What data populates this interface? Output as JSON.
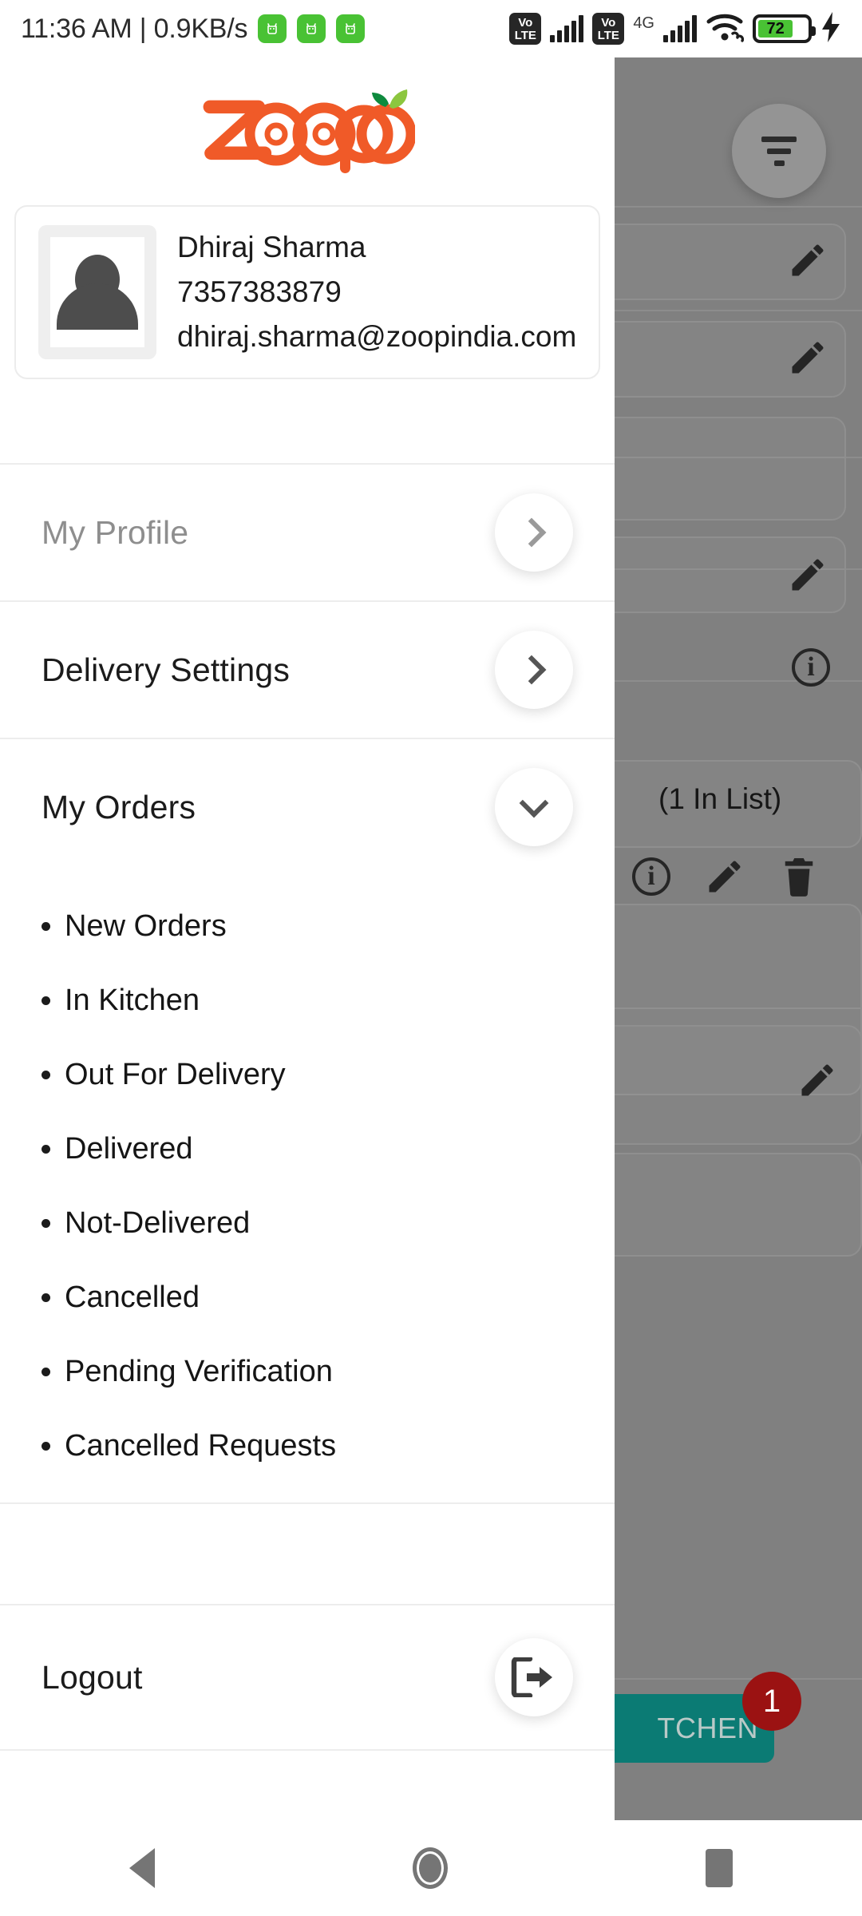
{
  "status_bar": {
    "time_and_speed": "11:36 AM | 0.9KB/s",
    "notification_icons": [
      "android-app-icon",
      "android-app-icon",
      "android-app-icon"
    ],
    "sim1": {
      "volte_top": "Vo",
      "volte_bottom": "LTE"
    },
    "sim2": {
      "volte_top": "Vo",
      "volte_bottom": "LTE",
      "network": "4G"
    },
    "wifi_icon": "wifi-icon",
    "battery": {
      "level": "72",
      "percent": 72,
      "charging": true
    }
  },
  "drawer": {
    "logo": {
      "text": "zoop",
      "brand_color": "#F05A28",
      "leaf_color_light": "#8CC63F",
      "leaf_color_dark": "#0E8A3E"
    },
    "profile": {
      "avatar_icon": "person-avatar-icon",
      "name": "Dhiraj Sharma",
      "phone": "7357383879",
      "email": "dhiraj.sharma@zoopindia.com"
    },
    "menu": [
      {
        "label": "My Profile",
        "icon": "chevron-right-icon",
        "muted": true,
        "expanded": false
      },
      {
        "label": "Delivery Settings",
        "icon": "chevron-right-icon",
        "muted": false,
        "expanded": false
      },
      {
        "label": "My Orders",
        "icon": "chevron-down-icon",
        "muted": false,
        "expanded": true
      }
    ],
    "submenu": [
      {
        "label": "New Orders"
      },
      {
        "label": "In Kitchen"
      },
      {
        "label": "Out For Delivery"
      },
      {
        "label": "Delivered"
      },
      {
        "label": "Not-Delivered"
      },
      {
        "label": "Cancelled"
      },
      {
        "label": "Pending Verification"
      },
      {
        "label": "Cancelled Requests"
      }
    ],
    "logout": {
      "label": "Logout",
      "icon": "logout-exit-icon"
    }
  },
  "background_screen": {
    "scrim_color": "#808080",
    "filter_button_icon": "filter-icon",
    "in_list_text": "(1 In List)",
    "card_icons": [
      "pencil-edit-icon",
      "pencil-edit-icon",
      "pencil-edit-icon",
      "info-icon",
      "info-icon",
      "pencil-edit-icon",
      "trash-delete-icon",
      "pencil-edit-icon"
    ],
    "bottom_button": {
      "label": "TCHEN",
      "color": "#0b7b74",
      "badge_count": "1",
      "badge_color": "#9b1212"
    }
  },
  "nav_bar": {
    "back": "back-triangle-icon",
    "home": "home-circle-icon",
    "recents": "recents-square-icon"
  }
}
